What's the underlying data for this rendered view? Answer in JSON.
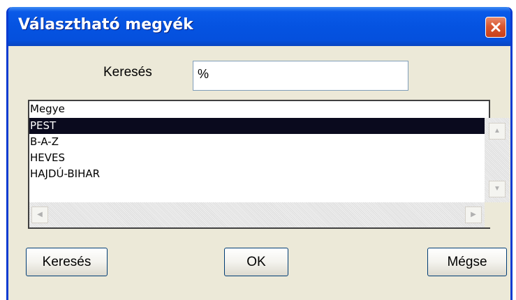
{
  "window": {
    "title": "Választható megyék"
  },
  "search": {
    "label": "Keresés",
    "value": "%"
  },
  "list": {
    "column_header": "Megye",
    "items": [
      "PEST",
      "B-A-Z",
      "HEVES",
      "HAJDÚ-BIHAR"
    ],
    "selected_index": 0
  },
  "buttons": {
    "search_label": "Keresés",
    "ok_label": "OK",
    "cancel_label": "Mégse"
  },
  "icons": {
    "close": "close-icon",
    "scroll_up": "arrow-up-icon",
    "scroll_down": "arrow-down-icon",
    "scroll_left": "arrow-left-icon",
    "scroll_right": "arrow-right-icon"
  },
  "colors": {
    "titlebar": "#0553e1",
    "close_button": "#d9572f",
    "dialog_background": "#ece9d8",
    "selection": "#0a0a1e"
  }
}
